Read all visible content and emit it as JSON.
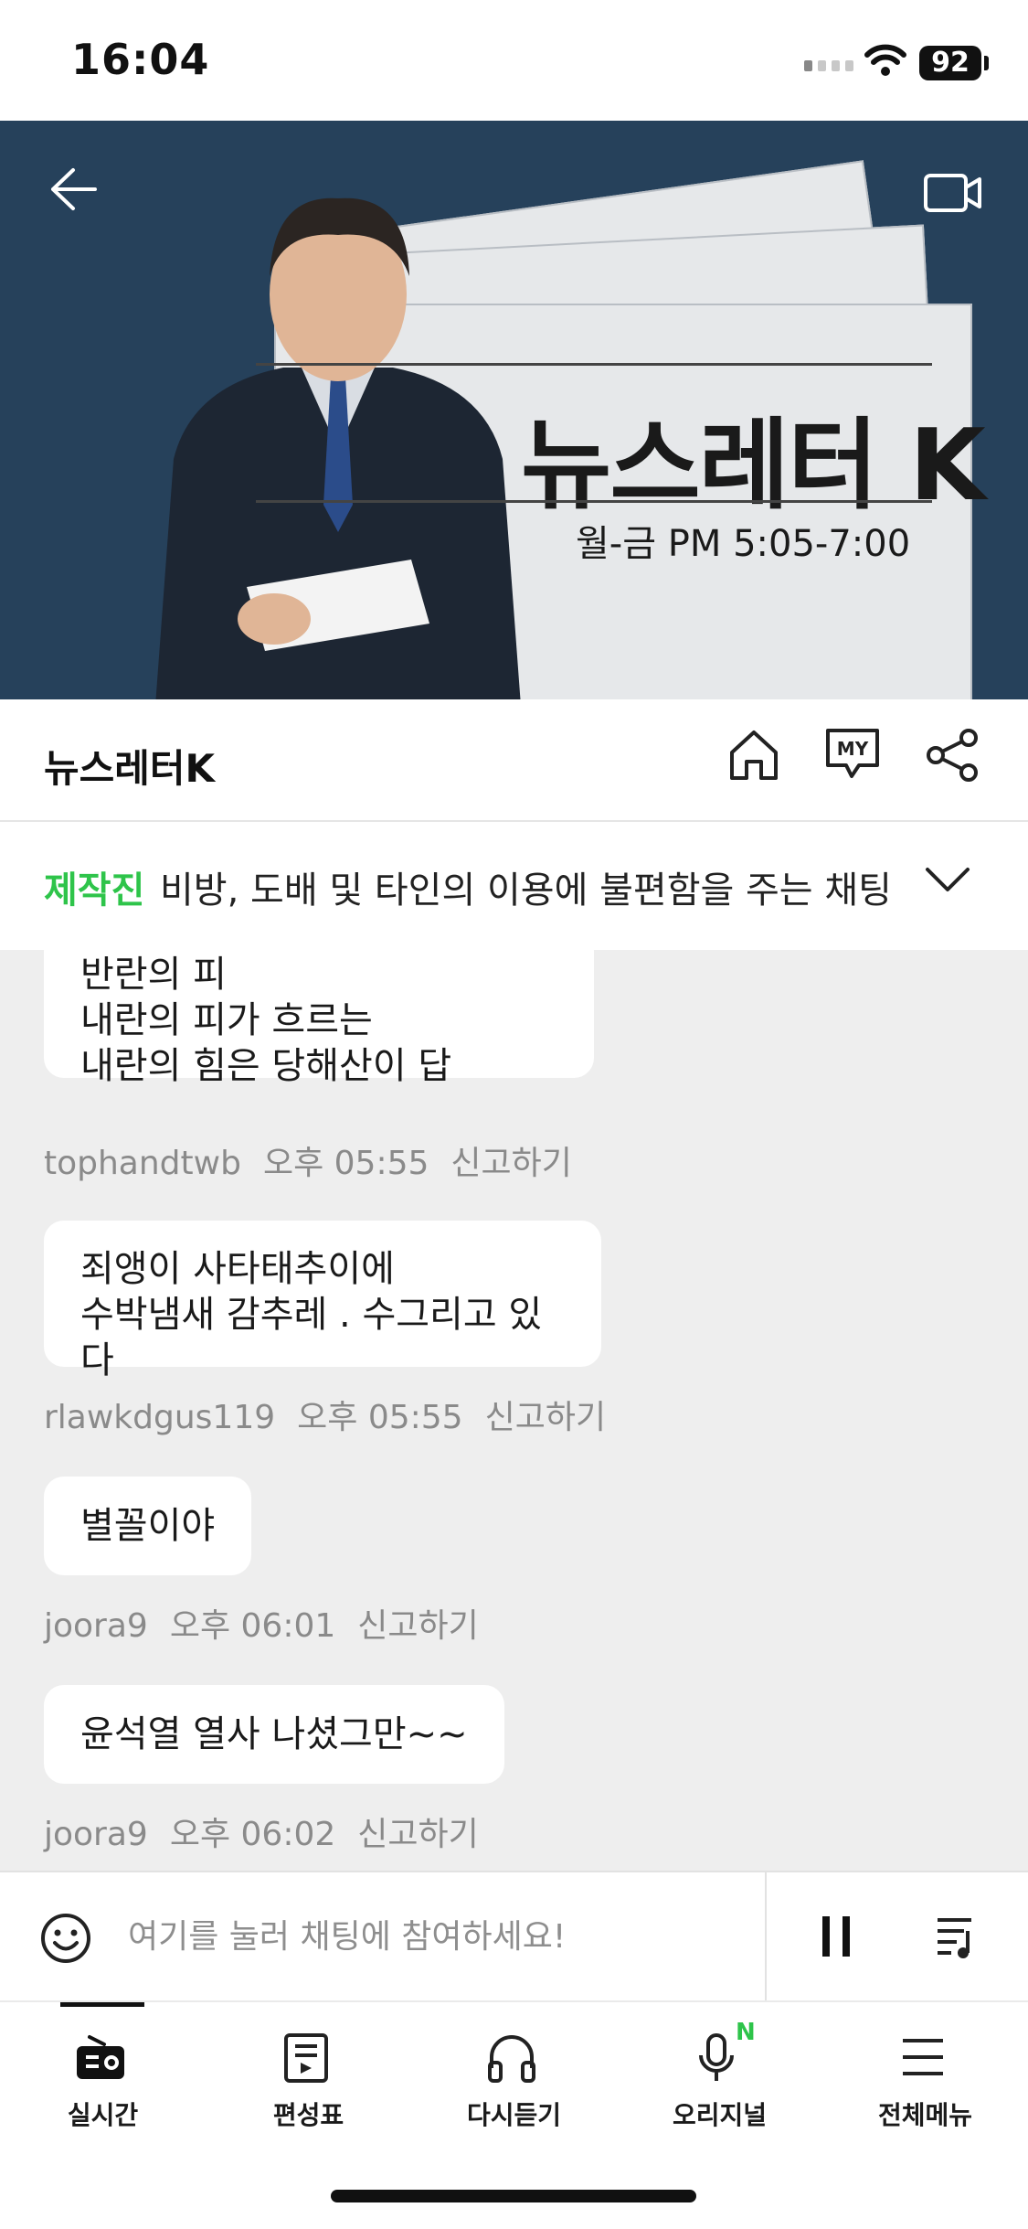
{
  "status": {
    "time": "16:04",
    "battery": "92"
  },
  "banner": {
    "title": "뉴스레터 K",
    "schedule": "월-금  PM 5:05-7:00"
  },
  "program": {
    "title": "뉴스레터K"
  },
  "notice": {
    "label": "제작진",
    "text": "비방, 도배 및 타인의 이용에 불편함을 주는 채팅"
  },
  "chat": {
    "messages": [
      {
        "lines": [
          "반란의 피",
          "내란의 피가 흐르는",
          "내란의 힘은 당해산이 답"
        ],
        "user": "tophandtwb",
        "time": "오후 05:55",
        "report": "신고하기"
      },
      {
        "lines": [
          "죄앵이 사타태추이에",
          "수박냄새 감추레 . 수그리고 있다"
        ],
        "user": "rlawkdgus119",
        "time": "오후 05:55",
        "report": "신고하기"
      },
      {
        "lines": [
          "별꼴이야"
        ],
        "user": "joora9",
        "time": "오후 06:01",
        "report": "신고하기"
      },
      {
        "lines": [
          "윤석열 열사 나셨그만~~"
        ],
        "user": "joora9",
        "time": "오후 06:02",
        "report": "신고하기"
      }
    ]
  },
  "input": {
    "placeholder": "여기를 눌러 채팅에 참여하세요!"
  },
  "nav": {
    "items": [
      {
        "label": "실시간",
        "icon": "radio-icon"
      },
      {
        "label": "편성표",
        "icon": "schedule-icon"
      },
      {
        "label": "다시듣기",
        "icon": "headphones-icon"
      },
      {
        "label": "오리지널",
        "icon": "microphone-icon",
        "badge": "N"
      },
      {
        "label": "전체메뉴",
        "icon": "menu-icon"
      }
    ]
  },
  "colors": {
    "accent": "#2ec44a",
    "banner_bg": "#26415b",
    "chat_bg": "#eeeeee"
  }
}
